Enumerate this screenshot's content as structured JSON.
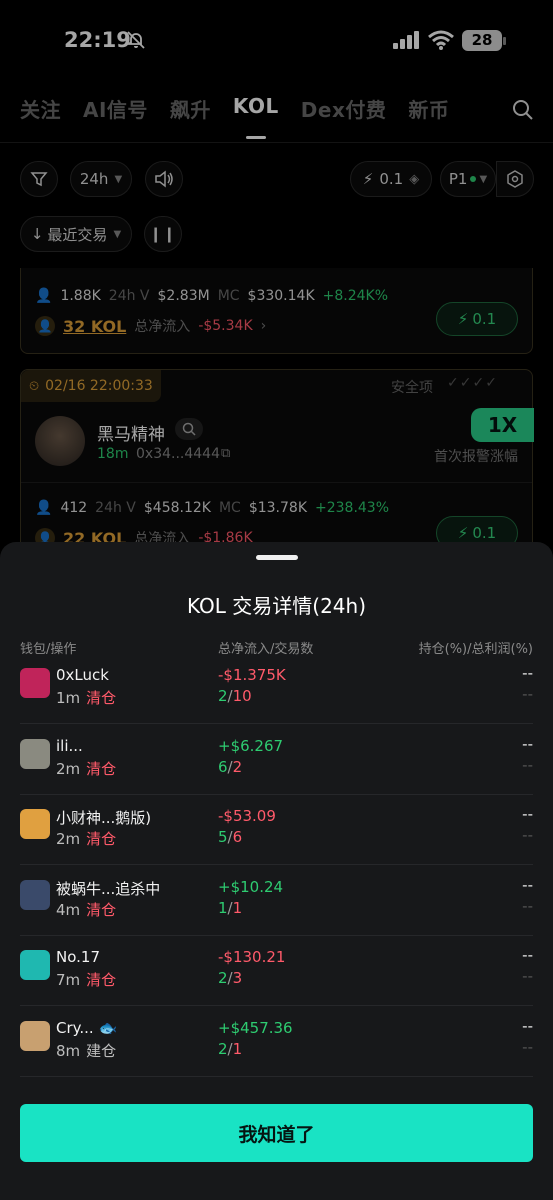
{
  "status": {
    "time": "22:19",
    "battery": "28"
  },
  "tabs": [
    "关注",
    "AI信号",
    "飙升",
    "KOL",
    "Dex付费",
    "新币"
  ],
  "active_tab": "KOL",
  "filters": {
    "timeframe": "24h",
    "quick_buy": "0.1",
    "preset": "P1",
    "sort": "最近交易"
  },
  "card1": {
    "holders": "1.88K",
    "vol_label": "24h V",
    "vol": "$2.83M",
    "mc_label": "MC",
    "mc": "$330.14K",
    "change": "+8.24K%",
    "kol": "32 KOL",
    "net_label": "总净流入",
    "net": "-$5.34K",
    "buy": "0.1"
  },
  "card2": {
    "timestamp": "02/16 22:00:33",
    "security_label": "安全项",
    "name": "黑马精神",
    "age": "18m",
    "address": "0x34...4444",
    "multiplier": "1X",
    "first_alert": "首次报警涨幅",
    "holders": "412",
    "vol_label": "24h V",
    "vol": "$458.12K",
    "mc_label": "MC",
    "mc": "$13.78K",
    "change": "+238.43%",
    "kol": "22 KOL",
    "net_label": "总净流入",
    "net": "-$1.86K",
    "buy": "0.1"
  },
  "sheet": {
    "title": "KOL 交易详情(24h)",
    "col_wallet": "钱包/操作",
    "col_flow": "总净流入/交易数",
    "col_hold": "持仓(%)/总利润(%)",
    "rows": [
      {
        "name": "0xLuck",
        "time": "1m",
        "action": "清仓",
        "action_type": "sell",
        "flow": "-$1.375K",
        "flow_sign": "neg",
        "buys": "2",
        "sells": "10",
        "hold": "--",
        "profit": "--",
        "avatar": "#c0245a"
      },
      {
        "name": "ili...",
        "time": "2m",
        "action": "清仓",
        "action_type": "sell",
        "flow": "+$6.267",
        "flow_sign": "pos",
        "buys": "6",
        "sells": "2",
        "hold": "--",
        "profit": "--",
        "avatar": "#8a8a80"
      },
      {
        "name": "小财神...鹅版)",
        "time": "2m",
        "action": "清仓",
        "action_type": "sell",
        "flow": "-$53.09",
        "flow_sign": "neg",
        "buys": "5",
        "sells": "6",
        "hold": "--",
        "profit": "--",
        "avatar": "#e0a040"
      },
      {
        "name": "被蜗牛...追杀中",
        "time": "4m",
        "action": "清仓",
        "action_type": "sell",
        "flow": "+$10.24",
        "flow_sign": "pos",
        "buys": "1",
        "sells": "1",
        "hold": "--",
        "profit": "--",
        "avatar": "#3a4a6a"
      },
      {
        "name": "No.17",
        "time": "7m",
        "action": "清仓",
        "action_type": "sell",
        "flow": "-$130.21",
        "flow_sign": "neg",
        "buys": "2",
        "sells": "3",
        "hold": "--",
        "profit": "--",
        "avatar": "#1fb8b0"
      },
      {
        "name": "Cry... 🐟",
        "time": "8m",
        "action": "建仓",
        "action_type": "buy",
        "flow": "+$457.36",
        "flow_sign": "pos",
        "buys": "2",
        "sells": "1",
        "hold": "--",
        "profit": "--",
        "avatar": "#c8a070"
      }
    ],
    "confirm": "我知道了"
  }
}
